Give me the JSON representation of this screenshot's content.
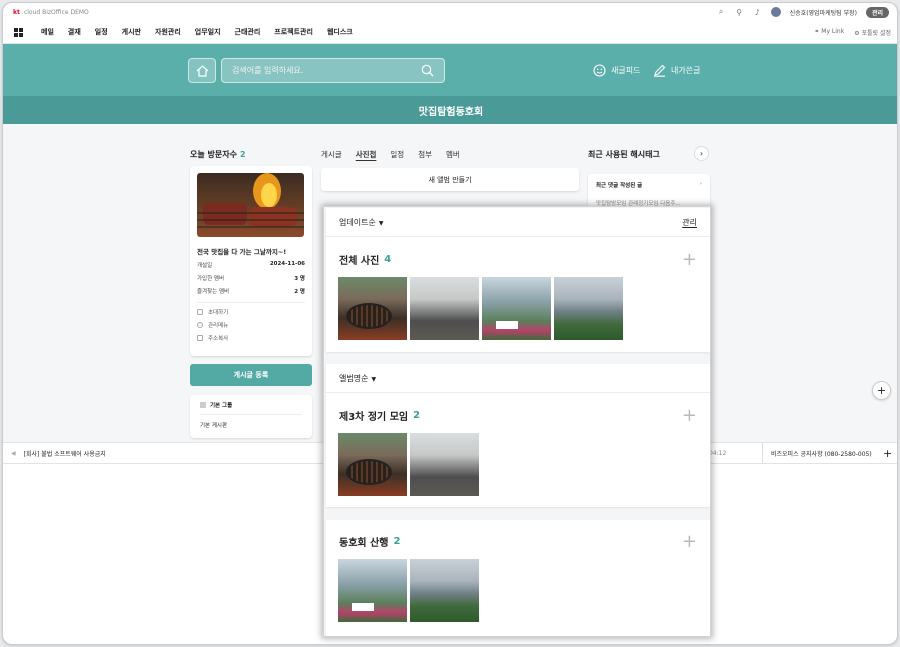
{
  "brand": {
    "kt": "kt",
    "name": "cloud BizOffice DEMO"
  },
  "user": {
    "name": "신승호(영업마케팅팀 부장)",
    "admin_label": "관리"
  },
  "menu": {
    "items": [
      "메일",
      "결재",
      "일정",
      "게시판",
      "자원관리",
      "업무일지",
      "근태관리",
      "프로젝트관리",
      "웹디스크"
    ],
    "mylink": "My Link",
    "settings": "포틀릿 설정"
  },
  "header": {
    "search_placeholder": "검색어를 입력하세요.",
    "feed_label": "새글피드",
    "mywrite_label": "내가쓴글",
    "club_name": "맛집탐험동호회"
  },
  "left": {
    "visitors_label": "오늘 방문자수",
    "visitors_count": "2",
    "club_title": "전국 맛집을 다 가는 그날까지~!",
    "info": [
      {
        "k": "개설일",
        "v": "2024-11-06"
      },
      {
        "k": "가입한 멤버",
        "v": "3 명"
      },
      {
        "k": "즐겨찾는 멤버",
        "v": "2 명"
      }
    ],
    "actions": [
      "초대하기",
      "관리메뉴",
      "주소복사"
    ],
    "write_btn": "게시글 등록",
    "board_group": "기본 그룹",
    "board_name": "기본 게시판"
  },
  "center": {
    "tabs": [
      "게시글",
      "사진첩",
      "일정",
      "첨부",
      "멤버"
    ],
    "active_tab": "사진첩",
    "new_album": "새 앨범 만들기"
  },
  "right": {
    "hashtag_title": "최근 사용된 해시태그",
    "recent_comment": "최근 댓글 작성된 글",
    "recent_post": "맛집탐방모임 관례정기모임 다음주..."
  },
  "notice": {
    "text": "[회사] 불법 소프트웨어 사용금지",
    "time": "04:12",
    "phone": "비즈오피스 공지사항 (080-2580-005)"
  },
  "popup": {
    "sort_update": "업데이트순",
    "manage": "관리",
    "all_title": "전체 사진",
    "all_count": "4",
    "sort_name": "앨범명순",
    "albums": [
      {
        "title": "제3차 정기 모임",
        "count": "2"
      },
      {
        "title": "동호회 산행",
        "count": "2"
      }
    ]
  },
  "colors": {
    "teal": "#5aafab",
    "teal_dark": "#4a9a97",
    "accent": "#3aa29b"
  }
}
